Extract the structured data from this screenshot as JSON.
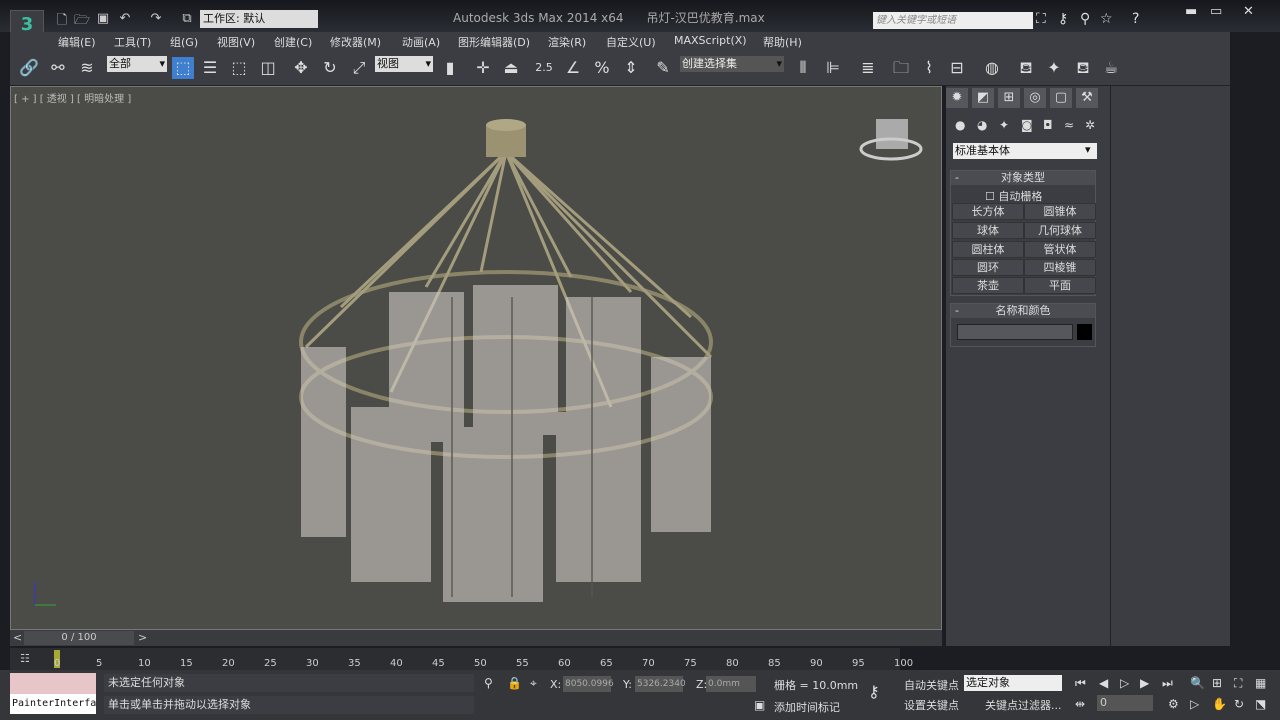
{
  "app": {
    "title": "Autodesk 3ds Max  2014 x64",
    "file": "吊灯-汉巴优教育.max",
    "logo": "3ds-max-logo",
    "workspace": "工作区: 默认",
    "search_placeholder": "键入关键字或短语"
  },
  "menu": [
    "编辑(E)",
    "工具(T)",
    "组(G)",
    "视图(V)",
    "创建(C)",
    "修改器(M)",
    "动画(A)",
    "图形编辑器(D)",
    "渲染(R)",
    "自定义(U)",
    "MAXScript(X)",
    "帮助(H)"
  ],
  "toolbar": {
    "filter": "全部",
    "ref_coord": "视图",
    "selection_set": "创建选择集",
    "snap_label": "2.5"
  },
  "viewport": {
    "label": "[ + ] [ 透视 ] [ 明暗处理 ]"
  },
  "command_panel": {
    "category": "标准基本体",
    "object_type_title": "对象类型",
    "autogrid": "自动栅格",
    "buttons": [
      "长方体",
      "圆锥体",
      "球体",
      "几何球体",
      "圆柱体",
      "管状体",
      "圆环",
      "四棱锥",
      "茶壶",
      "平面"
    ],
    "name_color_title": "名称和颜色",
    "name_value": "",
    "color": "#000000"
  },
  "timeline": {
    "frame": "0 / 100",
    "ticks": [
      "0",
      "5",
      "10",
      "15",
      "20",
      "25",
      "30",
      "35",
      "40",
      "45",
      "50",
      "55",
      "60",
      "65",
      "70",
      "75",
      "80",
      "85",
      "90",
      "95",
      "100"
    ]
  },
  "status": {
    "painter": "PainterInterface",
    "selection": "未选定任何对象",
    "prompt": "单击或单击并拖动以选择对象",
    "x_label": "X:",
    "x": "8050.0996",
    "y_label": "Y:",
    "y": "5326.2340",
    "z_label": "Z:",
    "z": "0.0mm",
    "grid": "栅格 = 10.0mm",
    "add_time_tag": "添加时间标记",
    "auto_key": "自动关键点",
    "set_key": "设置关键点",
    "key_mode": "选定对象",
    "key_filters": "关键点过滤器...",
    "current_frame": "0"
  }
}
